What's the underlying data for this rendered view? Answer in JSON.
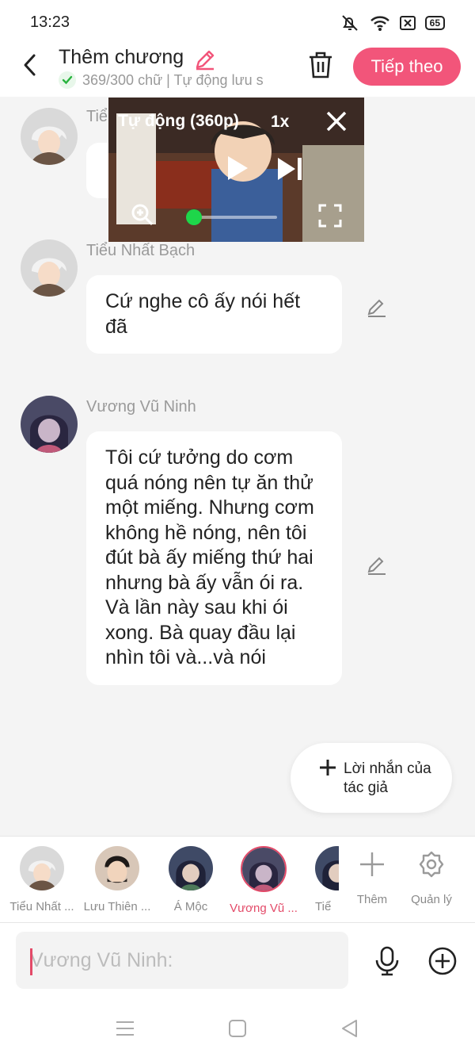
{
  "status": {
    "time": "13:23",
    "battery": "65"
  },
  "header": {
    "title": "Thêm chương",
    "subtitle": "369/300 chữ | Tự động lưu s",
    "next_label": "Tiếp theo"
  },
  "video": {
    "quality": "Tự động (360p)",
    "speed": "1x"
  },
  "messages": [
    {
      "sender": "Tiểu Nhất Bạch",
      "text": ""
    },
    {
      "sender": "Tiểu Nhất Bạch",
      "text": "Cứ nghe cô ấy nói hết đã"
    },
    {
      "sender": "Vương Vũ Ninh",
      "text": "Tôi cứ tưởng do cơm quá nóng nên tự ăn thử một miếng. Nhưng cơm không hề nóng, nên tôi đút bà ấy miếng thứ hai nhưng bà ấy vẫn ói ra. Và lần này sau khi ói xong. Bà quay đầu lại nhìn tôi và...và nói"
    }
  ],
  "author_note": {
    "label": "Lời nhắn của tác giả"
  },
  "characters": [
    {
      "name": "Tiểu Nhất ..."
    },
    {
      "name": "Lưu Thiên ..."
    },
    {
      "name": "Á Mộc"
    },
    {
      "name": "Vương Vũ ..."
    },
    {
      "name": "Tiể"
    }
  ],
  "char_actions": {
    "add": "Thêm",
    "manage": "Quản lý"
  },
  "input": {
    "placeholder": "Vương Vũ Ninh:"
  },
  "colors": {
    "accent": "#f2557a",
    "selected": "#e34a68",
    "progress": "#1ed64a"
  }
}
